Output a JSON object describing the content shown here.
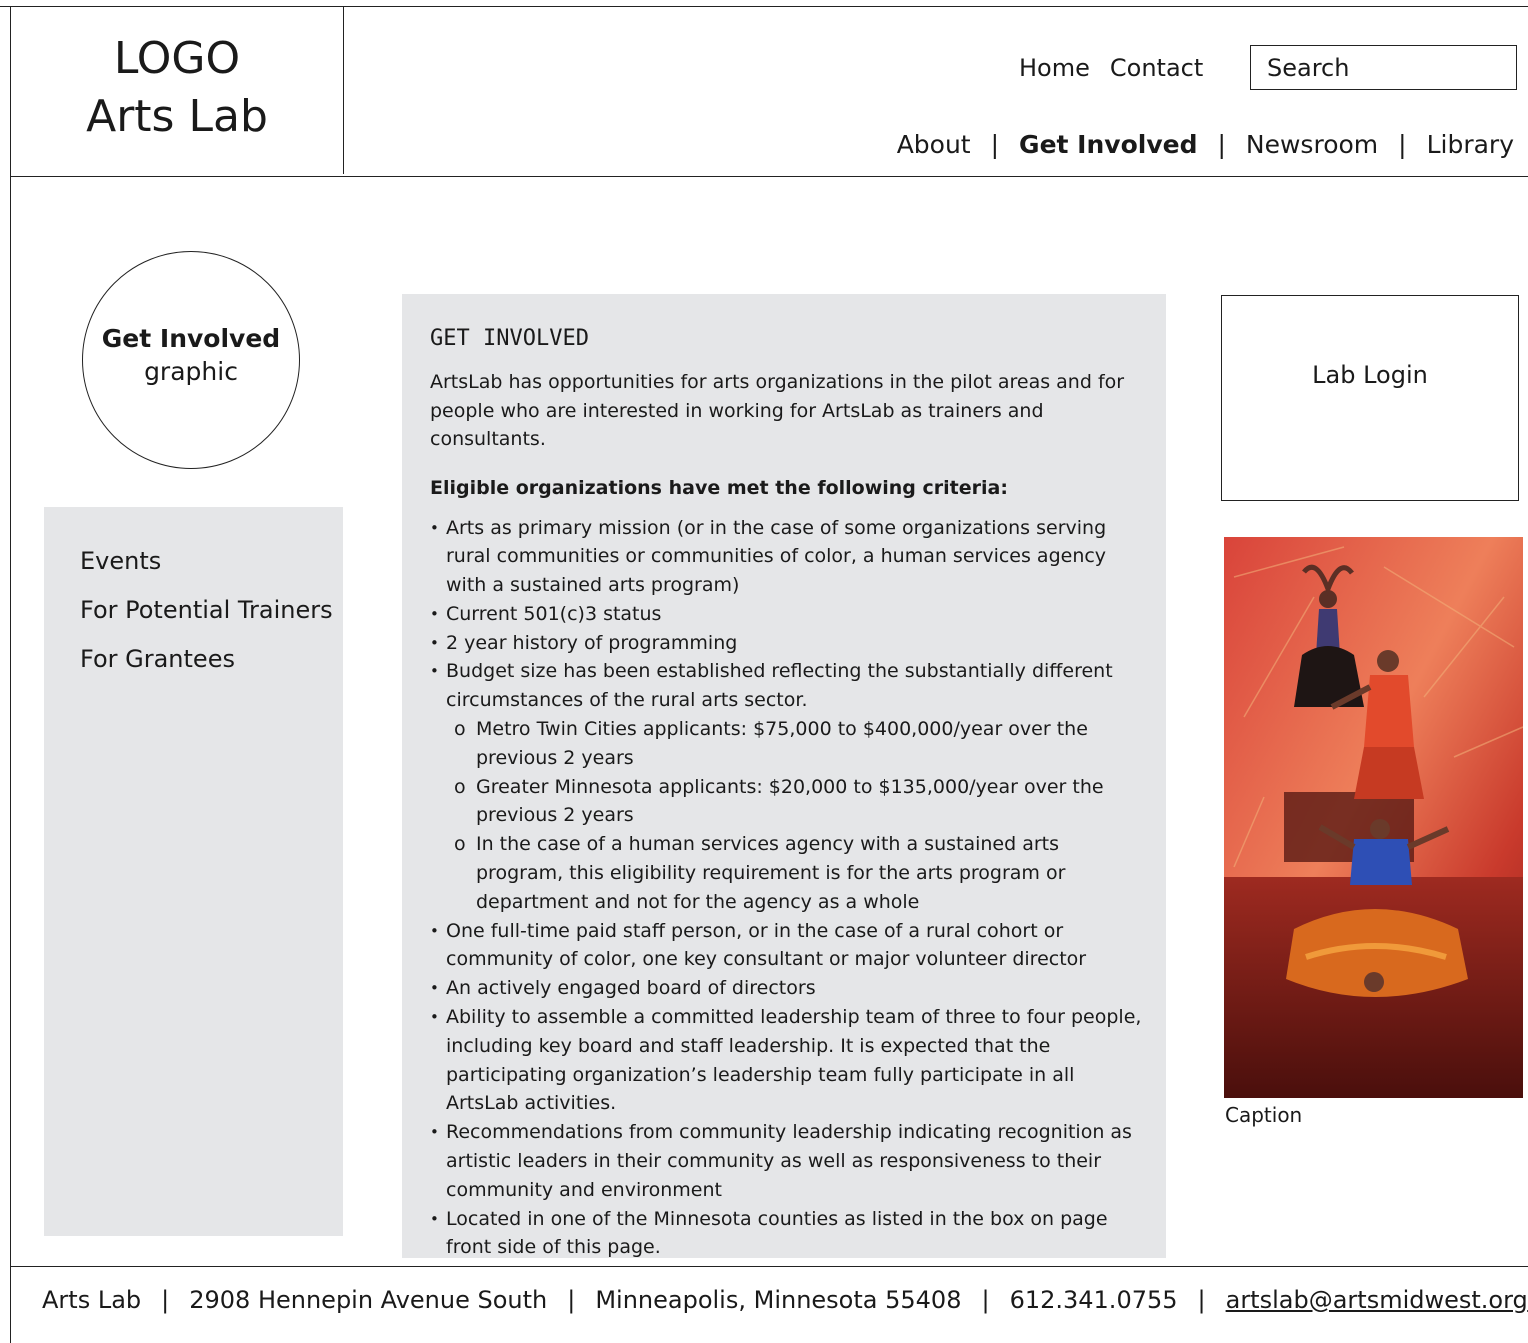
{
  "header": {
    "logo_line1": "LOGO",
    "logo_line2": "Arts Lab",
    "util_nav": {
      "home": "Home",
      "contact": "Contact"
    },
    "search_placeholder": "Search",
    "main_nav": {
      "about": "About",
      "get_involved": "Get Involved",
      "newsroom": "Newsroom",
      "library": "Library",
      "separator": "|"
    }
  },
  "graphic": {
    "title": "Get Involved",
    "subtitle": "graphic"
  },
  "sidebar": {
    "items": [
      "Events",
      "For Potential Trainers",
      "For Grantees"
    ]
  },
  "content": {
    "heading": "GET INVOLVED",
    "intro": "ArtsLab has opportunities for arts organizations in the pilot areas and for people who are interested in working for ArtsLab as trainers and consultants.",
    "criteria_heading": "Eligible organizations have met the following criteria:",
    "criteria": [
      "Arts as primary mission (or in the case of some organizations serving rural communities or communities of color, a human services agency with a sustained arts program)",
      "Current 501(c)3 status",
      "2 year history of programming",
      "Budget size has been established reflecting the substantially different circumstances of the rural arts sector.",
      "One full-time paid staff person, or in the case of a rural cohort or community of color, one key consultant or major volunteer director",
      "An actively engaged board of directors",
      "Ability to assemble a committed leadership team of three to four people, including key board and staff leadership.  It is expected that the participating organization’s leadership team fully participate in all ArtsLab activities.",
      "Recommendations from community leadership indicating recognition as artistic leaders in their community as well as responsiveness to their community and environment",
      "Located in one of the Minnesota counties as listed in the box on page front side of this page."
    ],
    "sub_marker": "o",
    "budget_subs": [
      "Metro Twin Cities applicants: $75,000 to $400,000/year over the previous 2 years",
      "Greater Minnesota applicants: $20,000 to $135,000/year over the previous 2 years",
      "In the case of a human services agency with a sustained arts program, this eligibility requirement is for the arts program or department and not for the agency as a whole"
    ]
  },
  "right": {
    "login": "Lab Login",
    "caption": "Caption"
  },
  "footer": {
    "org": "Arts Lab",
    "address": "2908 Hennepin Avenue South",
    "city": "Minneapolis, Minnesota  55408",
    "phone": "612.341.0755",
    "email": "artslab@artsmidwest.org",
    "separator": "|"
  }
}
